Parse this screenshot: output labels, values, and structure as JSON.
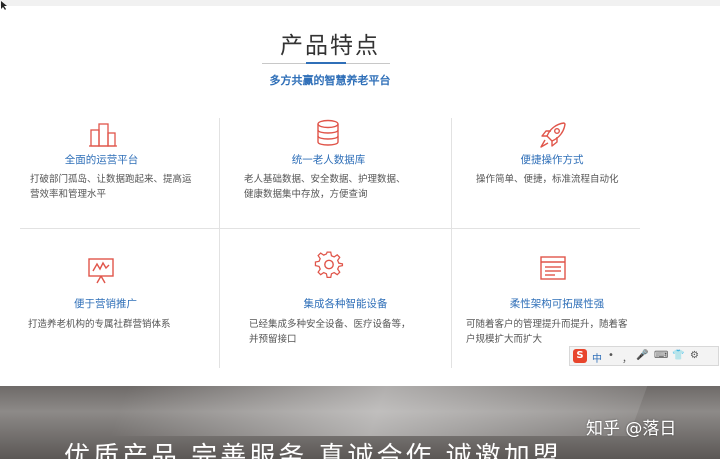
{
  "section": {
    "title": "产品特点",
    "subtitle": "多方共赢的智慧养老平台"
  },
  "features": [
    {
      "icon": "building-icon",
      "title": "全面的运营平台",
      "desc": "打破部门孤岛、让数据跑起来、提高运\n营效率和管理水平"
    },
    {
      "icon": "database-icon",
      "title": "统一老人数据库",
      "desc": "老人基础数据、安全数据、护理数据、\n健康数据集中存放，方便查询"
    },
    {
      "icon": "rocket-icon",
      "title": "便捷操作方式",
      "desc": "操作简单、便捷，标准流程自动化"
    },
    {
      "icon": "presentation-board-icon",
      "title": "便于营销推广",
      "desc": "打造养老机构的专属社群营销体系"
    },
    {
      "icon": "gear-icon",
      "title": "集成各种智能设备",
      "desc": "已经集成多种安全设备、医疗设备等，\n并预留接口"
    },
    {
      "icon": "layout-window-icon",
      "title": "柔性架构可拓展性强",
      "desc": "可随着客户的管理提升而提升，随着客\n户规模扩大而扩大"
    }
  ],
  "banner": {
    "text": "优质产品 完善服务 真诚合作 诚邀加盟"
  },
  "ime_toolbar": {
    "logo": "S",
    "mode": "中",
    "items": [
      "•",
      "，",
      "🎤",
      "⌨",
      "👕",
      "⚙"
    ]
  },
  "watermark": "知乎 @落日",
  "colors": {
    "accent_blue": "#2f6fb8",
    "icon_red": "#e0554a",
    "divider": "#e2e2e2"
  }
}
